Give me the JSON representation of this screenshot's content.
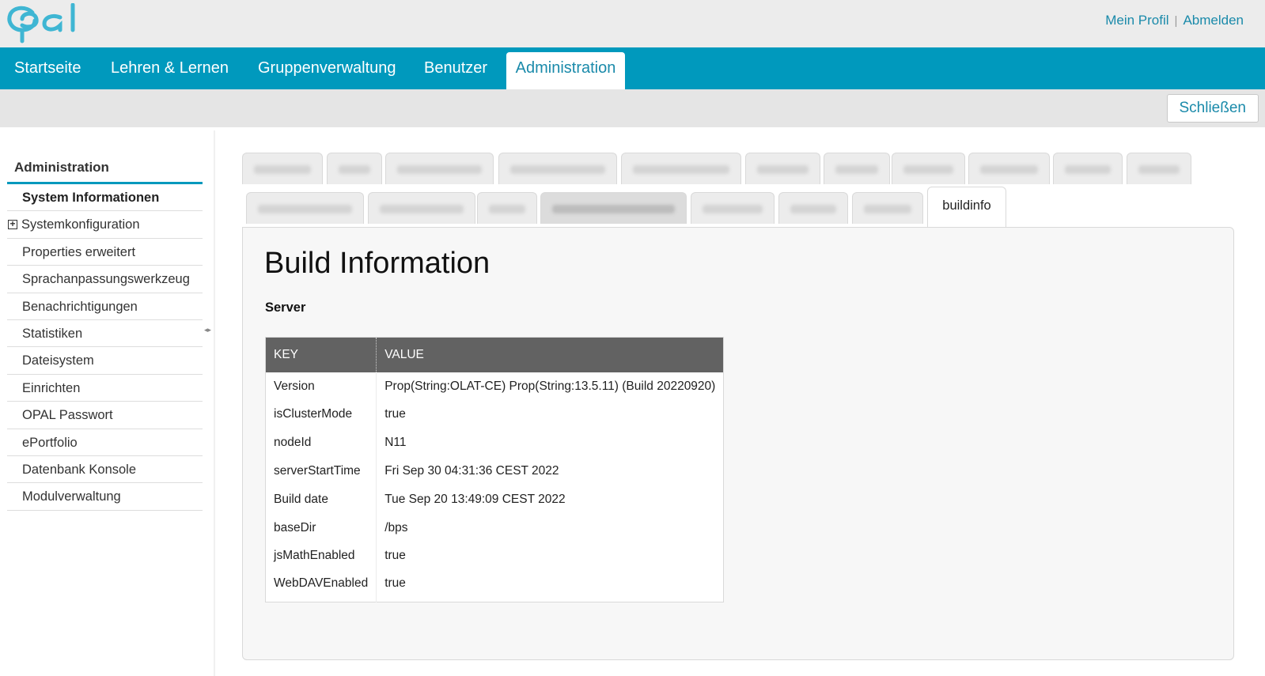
{
  "header": {
    "logo_text": "Opal",
    "profile_link": "Mein Profil",
    "separator": "|",
    "logout_link": "Abmelden"
  },
  "nav": {
    "items": [
      {
        "label": "Startseite"
      },
      {
        "label": "Lehren & Lernen"
      },
      {
        "label": "Gruppenverwaltung"
      },
      {
        "label": "Benutzer"
      },
      {
        "label": "Administration",
        "active": true
      }
    ]
  },
  "subbar": {
    "close_label": "Schließen"
  },
  "sidebar": {
    "title": "Administration",
    "items": [
      {
        "label": "System Informationen",
        "active": true
      },
      {
        "label": "Systemkonfiguration",
        "expandable": true
      },
      {
        "label": "Properties erweitert"
      },
      {
        "label": "Sprachanpassungswerkzeug"
      },
      {
        "label": "Benachrichtigungen"
      },
      {
        "label": "Statistiken"
      },
      {
        "label": "Dateisystem"
      },
      {
        "label": "Einrichten"
      },
      {
        "label": "OPAL Passwort"
      },
      {
        "label": "ePortfolio"
      },
      {
        "label": "Datenbank Konsole"
      },
      {
        "label": "Modulverwaltung"
      }
    ]
  },
  "tabs": {
    "active_label": "buildinfo"
  },
  "content": {
    "title": "Build Information",
    "section": "Server",
    "table": {
      "headers": [
        "KEY",
        "VALUE"
      ],
      "rows": [
        [
          "Version",
          "Prop(String:OLAT-CE) Prop(String:13.5.11) (Build 20220920)"
        ],
        [
          "isClusterMode",
          "true"
        ],
        [
          "nodeId",
          "N11"
        ],
        [
          "serverStartTime",
          "Fri Sep 30 04:31:36 CEST 2022"
        ],
        [
          "Build date",
          "Tue Sep 20 13:49:09 CEST 2022"
        ],
        [
          "baseDir",
          "/bps"
        ],
        [
          "jsMathEnabled",
          "true"
        ],
        [
          "WebDAVEnabled",
          "true"
        ]
      ]
    }
  }
}
